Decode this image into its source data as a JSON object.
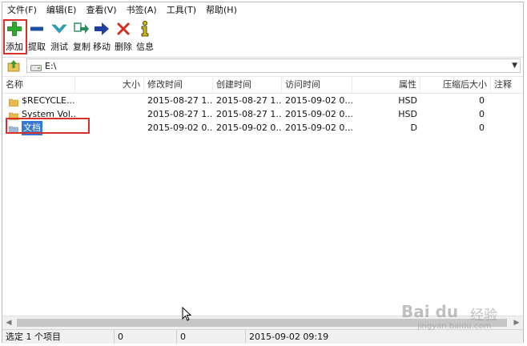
{
  "menu": [
    "文件(F)",
    "编辑(E)",
    "查看(V)",
    "书签(A)",
    "工具(T)",
    "帮助(H)"
  ],
  "toolbar": [
    {
      "label": "添加",
      "icon": "add-icon",
      "color": "#2fa82f"
    },
    {
      "label": "提取",
      "icon": "extract-icon",
      "color": "#1f4fa3"
    },
    {
      "label": "测试",
      "icon": "test-icon",
      "color": "#27a6c4"
    },
    {
      "label": "复制",
      "icon": "copy-icon",
      "color": "#2a8a5a"
    },
    {
      "label": "移动",
      "icon": "move-icon",
      "color": "#1f3f9a"
    },
    {
      "label": "删除",
      "icon": "delete-icon",
      "color": "#d52b1e"
    },
    {
      "label": "信息",
      "icon": "info-icon",
      "color": "#d8b800"
    }
  ],
  "address": {
    "path": "E:\\"
  },
  "columns": [
    "名称",
    "大小",
    "修改时间",
    "创建时间",
    "访问时间",
    "属性",
    "压缩后大小",
    "注释"
  ],
  "rows": [
    {
      "name": "$RECYCLE....",
      "size": "",
      "modified": "2015-08-27 1...",
      "created": "2015-08-27 1...",
      "accessed": "2015-09-02 0...",
      "attr": "HSD",
      "packed": "0",
      "comment": ""
    },
    {
      "name": "System Vol...",
      "size": "",
      "modified": "2015-08-27 1...",
      "created": "2015-08-27 1...",
      "accessed": "2015-09-02 0...",
      "attr": "HSD",
      "packed": "0",
      "comment": ""
    },
    {
      "name": "文档",
      "size": "",
      "modified": "2015-09-02 0...",
      "created": "2015-09-02 0...",
      "accessed": "2015-09-02 0...",
      "attr": "D",
      "packed": "0",
      "comment": ""
    }
  ],
  "selected_row": 2,
  "status": {
    "selection": "选定 1 个项目",
    "size": "0",
    "packed": "0",
    "datetime": "2015-09-02 09:19"
  },
  "watermark": {
    "brand": "Bai du",
    "jingyan": "经验",
    "url": "jingyan.baidu.com"
  },
  "colors": {
    "highlight_frame": "#d9302c",
    "selection": "#3379d4",
    "folder": "#e8b84a"
  }
}
